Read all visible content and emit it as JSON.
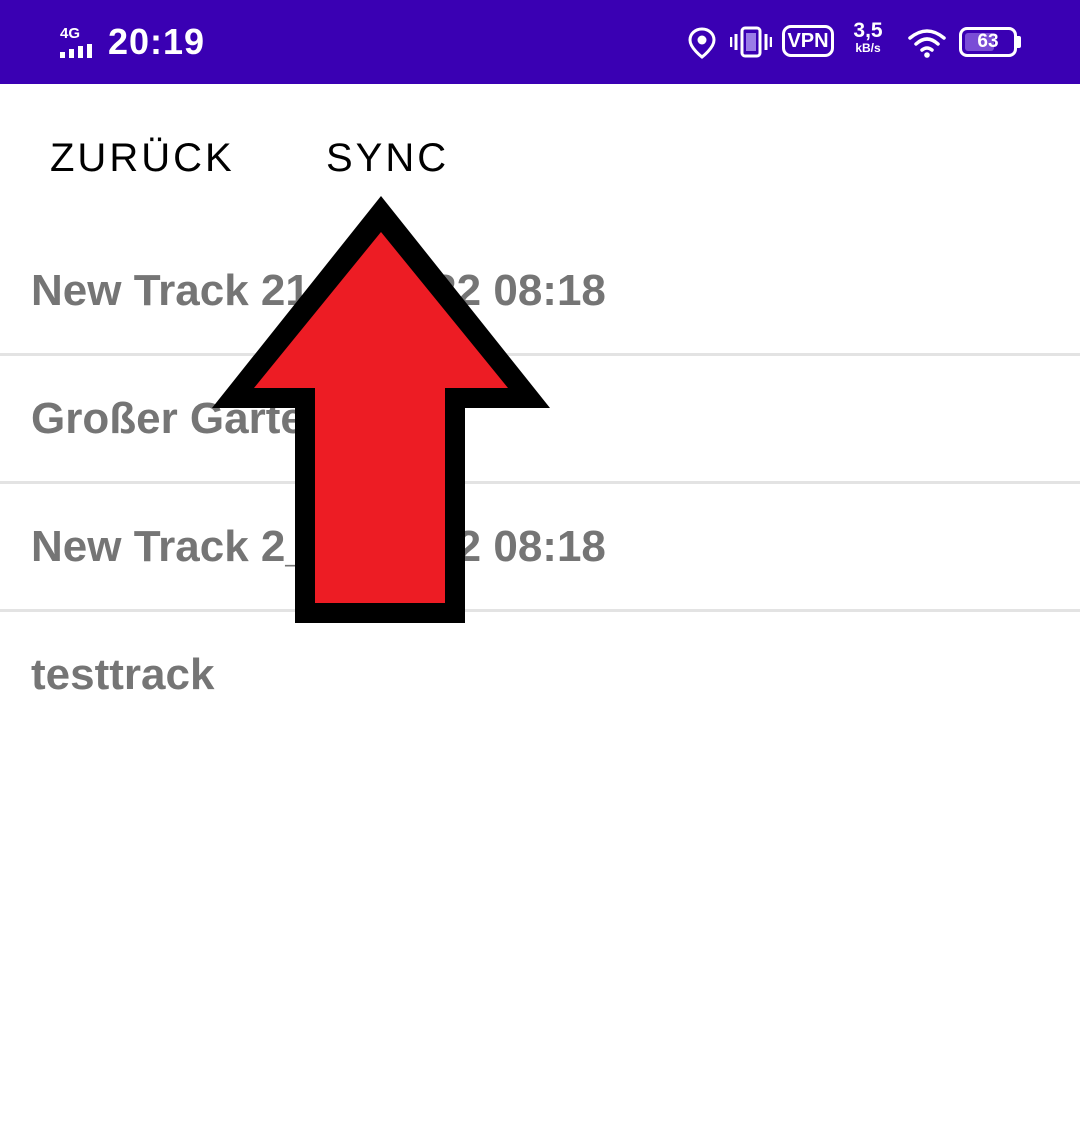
{
  "status_bar": {
    "network_type": "4G",
    "time": "20:19",
    "vpn_label": "VPN",
    "speed_value": "3,5",
    "speed_unit": "kB/s",
    "battery_percent": 63,
    "battery_label": "63",
    "icons": [
      "signal-icon",
      "location-icon",
      "vibrate-icon",
      "vpn-icon",
      "wifi-icon",
      "battery-icon"
    ]
  },
  "toolbar": {
    "back_label": "ZURÜCK",
    "sync_label": "SYNC"
  },
  "tracks": [
    {
      "label": "New Track 21.__.2022 08:18"
    },
    {
      "label": "Großer Garte"
    },
    {
      "label": "New Track 2_.__.2022 08:18"
    },
    {
      "label": "testtrack"
    }
  ],
  "annotation": {
    "type": "arrow-up",
    "fill_color": "#ed1c24",
    "stroke_color": "#000000",
    "points_to": "sync-button"
  },
  "colors": {
    "status_bar_bg": "#3a00b3",
    "track_text": "#757575",
    "divider": "#e3e3e3"
  }
}
